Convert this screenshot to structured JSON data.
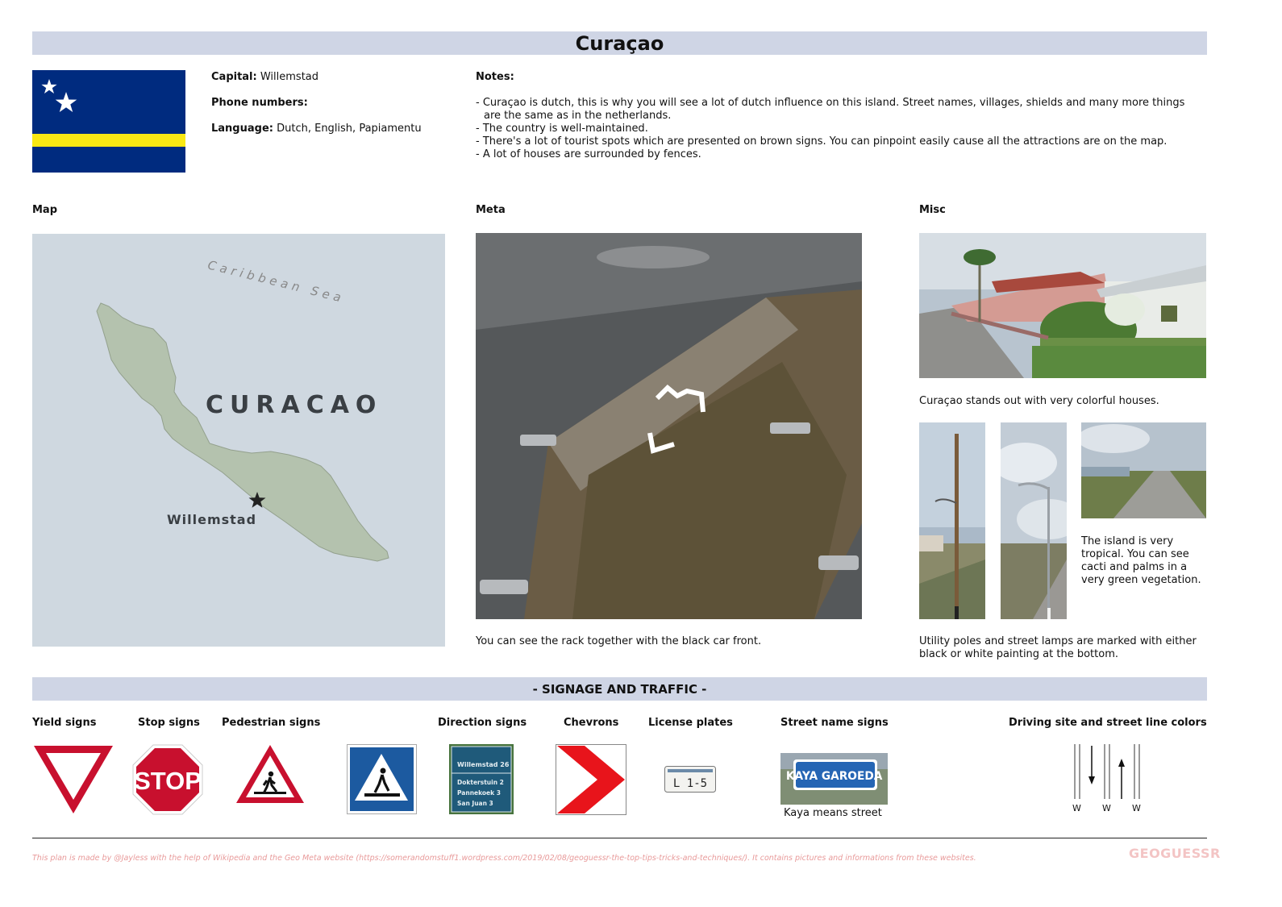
{
  "header": {
    "title": "Curaçao"
  },
  "info": {
    "capital_label": "Capital:",
    "capital_value": "Willemstad",
    "phone_label": "Phone numbers:",
    "phone_value": "",
    "language_label": "Language:",
    "language_value": "Dutch, English, Papiamentu"
  },
  "notes": {
    "heading": "Notes:",
    "items": [
      "- Curaçao is dutch, this is why you will see a lot of dutch influence on this island. Street names, villages, shields and many more things are the same as in the netherlands.",
      "- The country is well-maintained.",
      "- There's a lot of tourist spots which are presented on brown signs. You can pinpoint easily cause all the attractions are on the map.",
      "- A lot of houses are surrounded by fences."
    ]
  },
  "sections": {
    "map": "Map",
    "meta": "Meta",
    "misc": "Misc"
  },
  "map": {
    "sea_label": "Caribbean Sea",
    "country_label": "CURACAO",
    "city_label": "Willemstad",
    "colors": {
      "water": "#cfd8e0",
      "land": "#b4c2ae"
    }
  },
  "captions": {
    "meta": "You can see the rack together with the black car front.",
    "houses": "Curaçao stands out with very colorful houses.",
    "tropical": "The island is very tropical. You can see cacti and palms in a very green vegetation.",
    "poles": "Utility poles and street lamps are marked with either black or white painting at the bottom."
  },
  "signage": {
    "heading": "- SIGNAGE AND TRAFFIC -",
    "labels": {
      "yield": "Yield signs",
      "stop": "Stop signs",
      "pedestrian": "Pedestrian signs",
      "direction": "Direction signs",
      "chevrons": "Chevrons",
      "plates": "License plates",
      "street": "Street name signs",
      "driving": "Driving site and street line colors"
    },
    "stop_text": "STOP",
    "direction_sign": {
      "top": "Willemstad 26",
      "rows": [
        "Dokterstuin 2",
        "Pannekoek 3",
        "San Juan 3"
      ]
    },
    "plate_text": "L 1-5",
    "street_sign_text": "KAYA GAROEDA",
    "street_caption": "Kaya means street",
    "line_labels": [
      "W",
      "W",
      "W"
    ]
  },
  "footer": {
    "credit": "This plan is made by @Jayless with the help of Wikipedia and the Geo Meta website (https://somerandomstuff1.wordpress.com/2019/02/08/geoguessr-the-top-tips-tricks-and-techniques/). It contains pictures and informations from these websites.",
    "logo": "GEOGUESSR"
  },
  "colors": {
    "header_bar": "#cfd5e5",
    "flag_blue": "#002b7f",
    "flag_yellow": "#f9e814",
    "sign_red": "#c8102e",
    "ped_blue": "#1c5aa0"
  }
}
